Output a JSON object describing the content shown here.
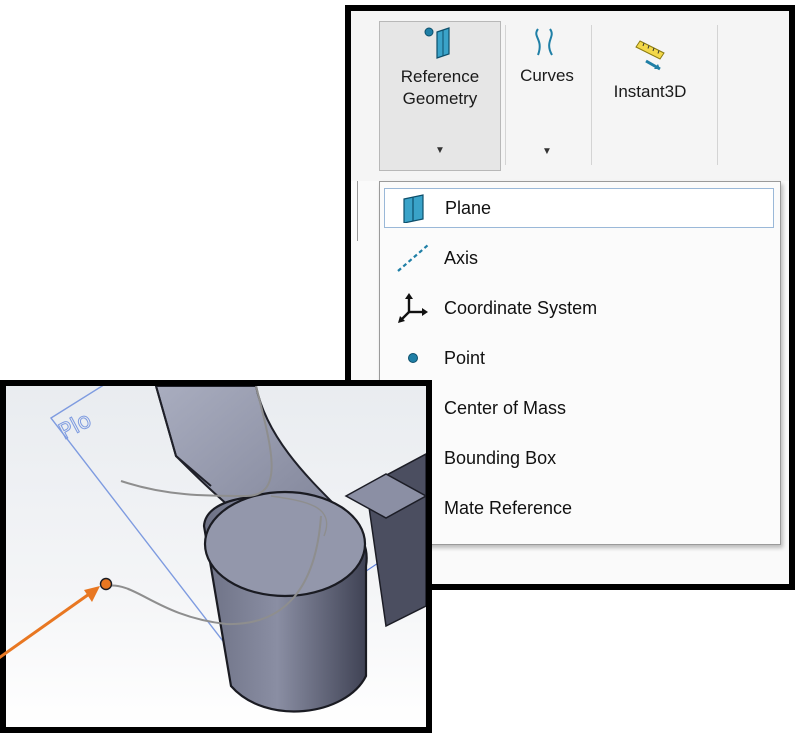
{
  "ribbon": {
    "reference_geometry_label": "Reference\nGeometry",
    "curves_label": "Curves",
    "instant3d_label": "Instant3D",
    "dropdown_caret": "▼"
  },
  "menu": {
    "items": [
      {
        "label": "Plane",
        "icon": "plane-icon"
      },
      {
        "label": "Axis",
        "icon": "axis-icon"
      },
      {
        "label": "Coordinate System",
        "icon": "coordinate-system-icon"
      },
      {
        "label": "Point",
        "icon": "point-icon"
      },
      {
        "label": "Center of Mass",
        "icon": ""
      },
      {
        "label": "Bounding Box",
        "icon": ""
      },
      {
        "label": "Mate Reference",
        "icon": ""
      }
    ],
    "selected": "Plane"
  },
  "inset": {
    "plane_tag": "Plo"
  },
  "colors": {
    "accent_orange": "#e87722",
    "plane_blue": "#6a8fd8",
    "icon_teal": "#1f7fa6"
  }
}
